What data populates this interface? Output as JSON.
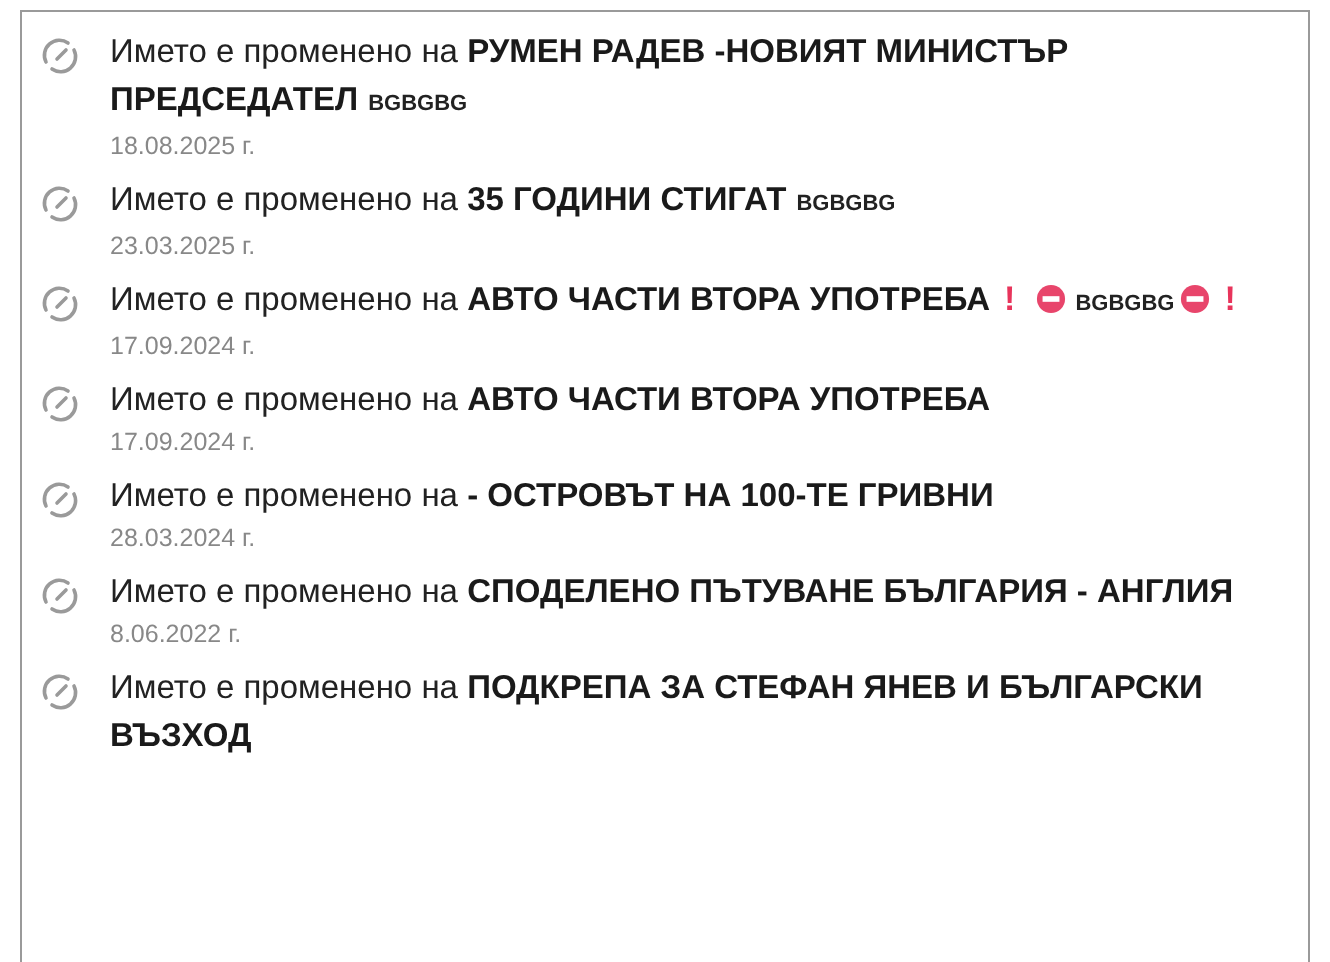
{
  "entries": [
    {
      "text": "Името е променено на **РУМЕН РАДЕВ -НОВИЯТ МИНИСТЪР ПРЕДСЕДАТЕЛ**",
      "tail": [
        {
          "kind": "tag",
          "text": "BGBGBG"
        }
      ],
      "date": "18.08.2025 г."
    },
    {
      "text": "Името е променено на **35 ГОДИНИ СТИГАТ**",
      "tail": [
        {
          "kind": "tag",
          "text": "BGBGBG"
        }
      ],
      "date": "23.03.2025 г."
    },
    {
      "text": "Името е променено на **АВТО ЧАСТИ ВТОРА УПОТРЕБА**",
      "tail": [
        {
          "kind": "exclaim",
          "text": "!"
        },
        {
          "kind": "no-entry"
        },
        {
          "kind": "tag",
          "text": "BGBGBG"
        },
        {
          "kind": "no-entry"
        },
        {
          "kind": "exclaim",
          "text": "!"
        }
      ],
      "date": "17.09.2024 г."
    },
    {
      "text": "Името е променено на **АВТО ЧАСТИ ВТОРА УПОТРЕБА**",
      "date": "17.09.2024 г."
    },
    {
      "text": "Името е променено на **- ОСТРОВЪТ НА 100-ТЕ ГРИВНИ**",
      "date": "28.03.2024 г."
    },
    {
      "text": "Името е променено на **СПОДЕЛЕНО ПЪТУВАНЕ БЪЛГАРИЯ - АНГЛИЯ**",
      "date": "8.06.2022 г."
    },
    {
      "text": "Името е променено на **ПОДКРЕПА ЗА СТЕФАН ЯНЕВ И БЪЛГАРСКИ ВЪЗХОД**"
    }
  ]
}
